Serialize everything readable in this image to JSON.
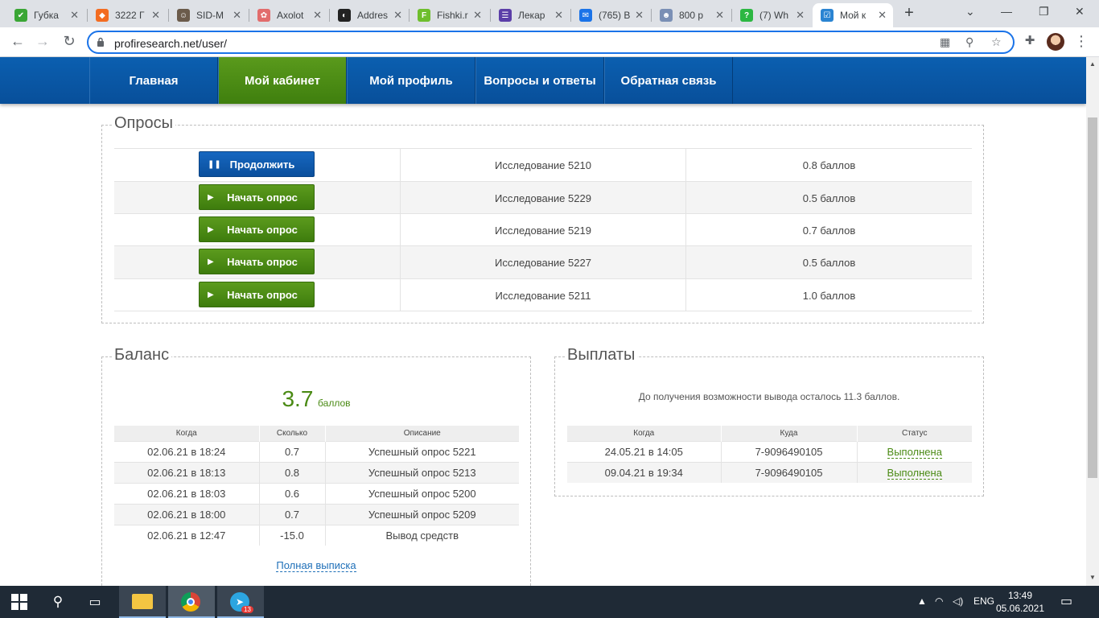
{
  "browser": {
    "tabs": [
      {
        "title": "Губка",
        "favicon_color": "#3aa635",
        "glyph": "✔"
      },
      {
        "title": "3222 Г",
        "favicon_color": "#f36c21",
        "glyph": "◆"
      },
      {
        "title": "SID-М",
        "favicon_color": "#6b5b4b",
        "glyph": "☺"
      },
      {
        "title": "Axolot",
        "favicon_color": "#e26c6c",
        "glyph": "✿"
      },
      {
        "title": "Addres",
        "favicon_color": "#222222",
        "glyph": "◐"
      },
      {
        "title": "Fishki.r",
        "favicon_color": "#6ebe2d",
        "glyph": "F"
      },
      {
        "title": "Лекар",
        "favicon_color": "#5b3ea8",
        "glyph": "☰"
      },
      {
        "title": "(765) В",
        "favicon_color": "#1a73e8",
        "glyph": "✉"
      },
      {
        "title": "800 р",
        "favicon_color": "#7a8fb5",
        "glyph": "☻"
      },
      {
        "title": "(7) Wh",
        "favicon_color": "#2cb742",
        "glyph": "?"
      },
      {
        "title": "Мой к",
        "favicon_color": "#2a84d2",
        "glyph": "☑"
      }
    ],
    "new_tab": "+",
    "url": "profiresearch.net/user/"
  },
  "nav": {
    "items": [
      "Главная",
      "Мой кабинет",
      "Мой профиль",
      "Вопросы и ответы",
      "Обратная связь"
    ],
    "active_index": 1
  },
  "surveys": {
    "title": "Опросы",
    "rows": [
      {
        "button": "Продолжить",
        "state": "pause",
        "study_label": "Исследование",
        "study_id": "5210",
        "points": "0.8 баллов"
      },
      {
        "button": "Начать опрос",
        "state": "start",
        "study_label": "Исследование",
        "study_id": "5229",
        "points": "0.5 баллов"
      },
      {
        "button": "Начать опрос",
        "state": "start",
        "study_label": "Исследование",
        "study_id": "5219",
        "points": "0.7 баллов"
      },
      {
        "button": "Начать опрос",
        "state": "start",
        "study_label": "Исследование",
        "study_id": "5227",
        "points": "0.5 баллов"
      },
      {
        "button": "Начать опрос",
        "state": "start",
        "study_label": "Исследование",
        "study_id": "5211",
        "points": "1.0 баллов"
      }
    ]
  },
  "balance": {
    "title": "Баланс",
    "value": "3.7",
    "unit": "баллов",
    "headers": [
      "Когда",
      "Сколько",
      "Описание"
    ],
    "rows": [
      [
        "02.06.21 в 18:24",
        "0.7",
        "Успешный опрос 5221"
      ],
      [
        "02.06.21 в 18:13",
        "0.8",
        "Успешный опрос 5213"
      ],
      [
        "02.06.21 в 18:03",
        "0.6",
        "Успешный опрос 5200"
      ],
      [
        "02.06.21 в 18:00",
        "0.7",
        "Успешный опрос 5209"
      ],
      [
        "02.06.21 в 12:47",
        "-15.0",
        "Вывод средств"
      ]
    ],
    "full_statement_link": "Полная выписка"
  },
  "payouts": {
    "title": "Выплаты",
    "note": "До получения возможности вывода осталось 11.3 баллов.",
    "headers": [
      "Когда",
      "Куда",
      "Статус"
    ],
    "rows": [
      [
        "24.05.21 в 14:05",
        "7-9096490105",
        "Выполнена"
      ],
      [
        "09.04.21 в 19:34",
        "7-9096490105",
        "Выполнена"
      ]
    ]
  },
  "taskbar": {
    "lang": "ENG",
    "time": "13:49",
    "date": "05.06.2021",
    "telegram_badge": "13"
  },
  "colors": {
    "nav_blue": "#0b5fb0",
    "accent_green": "#4a8a14",
    "button_green": "#4e8c16",
    "button_blue": "#1667c0"
  }
}
